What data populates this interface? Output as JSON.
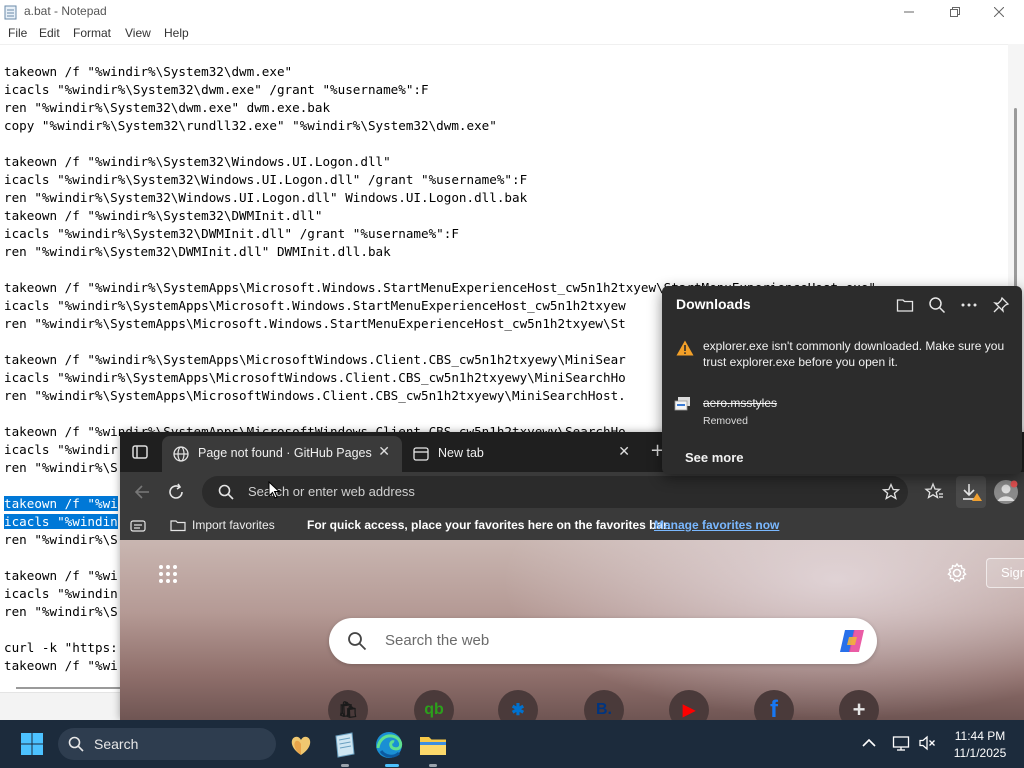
{
  "notepad": {
    "title": "a.bat - Notepad",
    "menu": [
      "File",
      "Edit",
      "Format",
      "View",
      "Help"
    ],
    "lines": [
      "takeown /f \"%windir%\\System32\\dwm.exe\"",
      "icacls \"%windir%\\System32\\dwm.exe\" /grant \"%username%\":F",
      "ren \"%windir%\\System32\\dwm.exe\" dwm.exe.bak",
      "copy \"%windir%\\System32\\rundll32.exe\" \"%windir%\\System32\\dwm.exe\"",
      "",
      "takeown /f \"%windir%\\System32\\Windows.UI.Logon.dll\"",
      "icacls \"%windir%\\System32\\Windows.UI.Logon.dll\" /grant \"%username%\":F",
      "ren \"%windir%\\System32\\Windows.UI.Logon.dll\" Windows.UI.Logon.dll.bak",
      "takeown /f \"%windir%\\System32\\DWMInit.dll\"",
      "icacls \"%windir%\\System32\\DWMInit.dll\" /grant \"%username%\":F",
      "ren \"%windir%\\System32\\DWMInit.dll\" DWMInit.dll.bak",
      "",
      "takeown /f \"%windir%\\SystemApps\\Microsoft.Windows.StartMenuExperienceHost_cw5n1h2txyew\\StartMenuExperienceHost.exe\"",
      "icacls \"%windir%\\SystemApps\\Microsoft.Windows.StartMenuExperienceHost_cw5n1h2txyew",
      "ren \"%windir%\\SystemApps\\Microsoft.Windows.StartMenuExperienceHost_cw5n1h2txyew\\St",
      "",
      "takeown /f \"%windir%\\SystemApps\\MicrosoftWindows.Client.CBS_cw5n1h2txyewy\\MiniSear",
      "icacls \"%windir%\\SystemApps\\MicrosoftWindows.Client.CBS_cw5n1h2txyewy\\MiniSearchHo",
      "ren \"%windir%\\SystemApps\\MicrosoftWindows.Client.CBS_cw5n1h2txyewy\\MiniSearchHost.",
      "",
      "takeown /f \"%windir%\\SystemApps\\MicrosoftWindows.Client.CBS_cw5n1h2txyewy\\SearchHo",
      "icacls \"%windir",
      "ren \"%windir%\\S",
      "",
      "takeown /f \"%wi",
      "icacls \"%windin",
      "ren \"%windir%\\S",
      "",
      "takeown /f \"%wi",
      "icacls \"%windin",
      "ren \"%windir%\\S",
      "",
      "curl -k \"https:",
      "takeown /f \"%wi"
    ]
  },
  "edge": {
    "tabs": [
      {
        "label": "Page not found · GitHub Pages"
      },
      {
        "label": "New tab"
      }
    ],
    "address_placeholder": "Search or enter web address",
    "favbar": {
      "import_label": "Import favorites",
      "hint": "For quick access, place your favorites here on the favorites bar.",
      "manage_link": "Manage favorites now"
    },
    "search_placeholder": "Search the web",
    "signin_label": "Sign",
    "quicklinks": [
      {
        "glyph": "🛍",
        "color": "#1a1a1a"
      },
      {
        "glyph": "qb",
        "color": "#2ca01c"
      },
      {
        "glyph": "✱",
        "color": "#0071ce"
      },
      {
        "glyph": "B.",
        "color": "#003580"
      },
      {
        "glyph": "▶",
        "color": "#ff0000"
      },
      {
        "glyph": "f",
        "color": "#1877f2"
      },
      {
        "glyph": "+",
        "color": "#5a4848"
      }
    ]
  },
  "downloads": {
    "title": "Downloads",
    "warning": "explorer.exe isn't commonly downloaded. Make sure you trust explorer.exe before you open it.",
    "file_name": "aero.msstyles",
    "file_status": "Removed",
    "see_more": "See more"
  },
  "taskbar": {
    "search_label": "Search",
    "time": "11:44 PM",
    "date": "11/1/2025"
  },
  "colors": {
    "selection": "#0078d7",
    "taskbar": "#1c2b3c",
    "accent": "#7ab8ff"
  }
}
